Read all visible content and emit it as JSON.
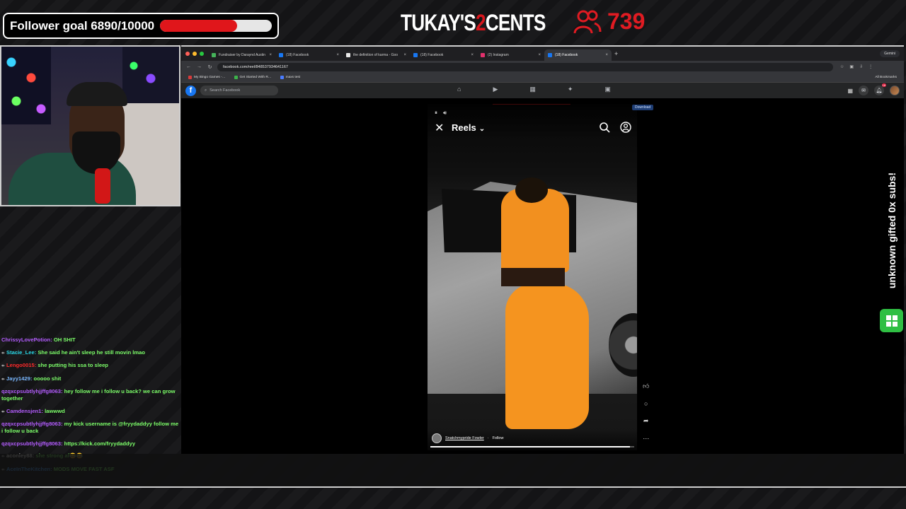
{
  "overlay": {
    "follower_goal_text": "Follower goal 6890/10000",
    "follower_goal_fraction": 0.689,
    "logo_left": "TUKAY'S",
    "logo_num": "2",
    "logo_right": "CENTS",
    "viewer_count": "739",
    "sub_alert": "unknown gifted 0x subs!",
    "accent_red": "#e0161b"
  },
  "chat": [
    {
      "user": "ChrissyLovePotion",
      "text": "OH SHIT",
      "color": "#b45dff",
      "tag": ""
    },
    {
      "user": "Stacie_Lee",
      "text": "She said he ain't sleep he still movin lmao",
      "color": "#29d7e6",
      "tag": "↞"
    },
    {
      "user": "Lengo0015",
      "text": "she putting his ssa to sleep",
      "color": "#ff2a2a",
      "tag": "↞"
    },
    {
      "user": "Jayy1429",
      "text": "ooooo shit",
      "color": "#7ab8ff",
      "tag": "↞"
    },
    {
      "user": "qzqxcpsubtlyhjjffg8063",
      "text": "hey follow me i follow u back? we can grow together",
      "color": "#b45dff",
      "tag": ""
    },
    {
      "user": "Camdensjen1",
      "text": "lawwwd",
      "color": "#b45dff",
      "tag": "↞"
    },
    {
      "user": "qzqxcpsubtlyhjjffg8063",
      "text": "my kick username is @fryydaddyy follow me i follow u back",
      "color": "#b45dff",
      "tag": ""
    },
    {
      "user": "qzqxcpsubtlyhjjffg8063",
      "text": "https://kick.com/fryydaddyy",
      "color": "#b45dff",
      "tag": ""
    },
    {
      "user": "aconley88",
      "text": "she strong af😂😂",
      "color": "#ffffff",
      "tag": "↞"
    },
    {
      "user": "AceInTheKitchen",
      "text": "MODS MOVE FAST ASF",
      "color": "#4aa3ff",
      "tag": "↞"
    }
  ],
  "browser": {
    "tabs": [
      {
        "label": "Fundraiser by Daraynd Austin",
        "color": "#45b35a",
        "active": false
      },
      {
        "label": "(18) Facebook",
        "color": "#1877f2",
        "active": false
      },
      {
        "label": "the definition of karma - Goo",
        "color": "#e8e8e8",
        "active": false
      },
      {
        "label": "(18) Facebook",
        "color": "#1877f2",
        "active": false
      },
      {
        "label": "(2) Instagram",
        "color": "#e1306c",
        "active": false
      },
      {
        "label": "(18) Facebook",
        "color": "#1877f2",
        "active": true
      }
    ],
    "gemini_label": "Gemini",
    "url": "facebook.com/reel/848537934641167",
    "bookmarks": [
      {
        "label": "My Bingo Games -…",
        "color": "#d93b3b"
      },
      {
        "label": "Get Started With R…",
        "color": "#3cb34a"
      },
      {
        "label": "maxs test",
        "color": "#4a7cff"
      }
    ],
    "all_bookmarks": "All Bookmarks"
  },
  "facebook": {
    "search_placeholder": "Search Facebook",
    "notification_count": "18",
    "download_label": "Download",
    "reel": {
      "title": "Reels",
      "author": "Snatchmypride Fowler",
      "follow": "Follow",
      "progress": 0.98
    }
  }
}
